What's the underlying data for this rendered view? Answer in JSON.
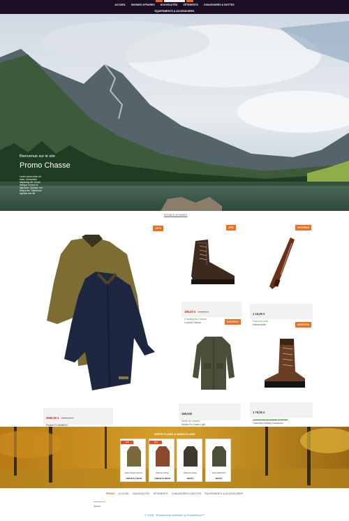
{
  "header": {
    "nav_items": [
      "ACCUEIL",
      "BONNES AFFAIRES",
      "NOUVEAUTÉS",
      "VÊTEMENTS",
      "CHAUSSURES & BOTTES"
    ],
    "nav_second": "EQUIPEMENTS & ACCESSOIRES"
  },
  "hero": {
    "kicker": "Bienvenue sur le site",
    "title": "Promo Chasse",
    "description": "Lorem ipsum dolor sit amet, consectetur adipiscing elit. Donec tristique in tortor et dignissim. Quisque non tempor leo. Maecenas egestas sed elit"
  },
  "products": {
    "section_link": "BONNES AFFAIRES",
    "items": [
      {
        "badge": "-20 %",
        "price": "3990,00 €",
        "old_price": "2400,00 €",
        "name": "Polaire FLAMINGO",
        "description": "",
        "price_red": true,
        "name_green": false,
        "name_strike": false
      },
      {
        "badge": "-85%",
        "price": "199,00 €",
        "old_price": "194,00 €",
        "name": "Chaussures Chasse",
        "description": "Cossack Okriess",
        "price_red": true,
        "name_green": true,
        "name_strike": false
      },
      {
        "badge": "NOUVEAU",
        "price": "1 10,00 €",
        "old_price": "",
        "name": "Fourreau fusil",
        "description": "Indestructible",
        "price_red": false,
        "name_green": true,
        "name_strike": false
      },
      {
        "badge": "NOUVEAU",
        "price": "199,00€",
        "old_price": "",
        "name": "Veste de chasse",
        "description": "Harkila Pro Hunter Light",
        "price_red": false,
        "name_green": true,
        "name_strike": false
      },
      {
        "badge": "NOUVEAU",
        "price": "1 79,00 €",
        "old_price": "",
        "name": "Chaussure de chasse Jonathan",
        "description": "Traversant Harkila Chaussures",
        "price_red": false,
        "name_green": true,
        "name_strike": true
      }
    ]
  },
  "band": {
    "title": "VENTE FLASH & BONS PLANS",
    "items": [
      {
        "badge": "-20%",
        "name": "Veste Chasse Homme",
        "price": "3 990,00 € 2 400,00"
      },
      {
        "badge": "-20%",
        "name": "Veste de chasse",
        "price": "4 999,00 € 3 999,00"
      },
      {
        "badge": "",
        "name": "Veste de chasse",
        "price": "199,00 €"
      },
      {
        "badge": "",
        "name": "Veste Harkila Pro",
        "price": "199,00 €"
      }
    ]
  },
  "footer": {
    "nav_items": [
      "PROMO",
      "ACCUEIL",
      "NOUVEAUTÉS",
      "VÊTEMENTS",
      "CHAUSSURES & BOTTES",
      "ÉQUIPEMENTS & ACCESSOIRES"
    ],
    "extra": "Stores",
    "copyright": "© 2018 - Ecommerce software by PrestaShop™"
  },
  "colors": {
    "accent": "#f06e22",
    "header_bg": "#1b0f26",
    "green_link": "#4c9a3a",
    "footer_link": "#3c8dbc"
  }
}
